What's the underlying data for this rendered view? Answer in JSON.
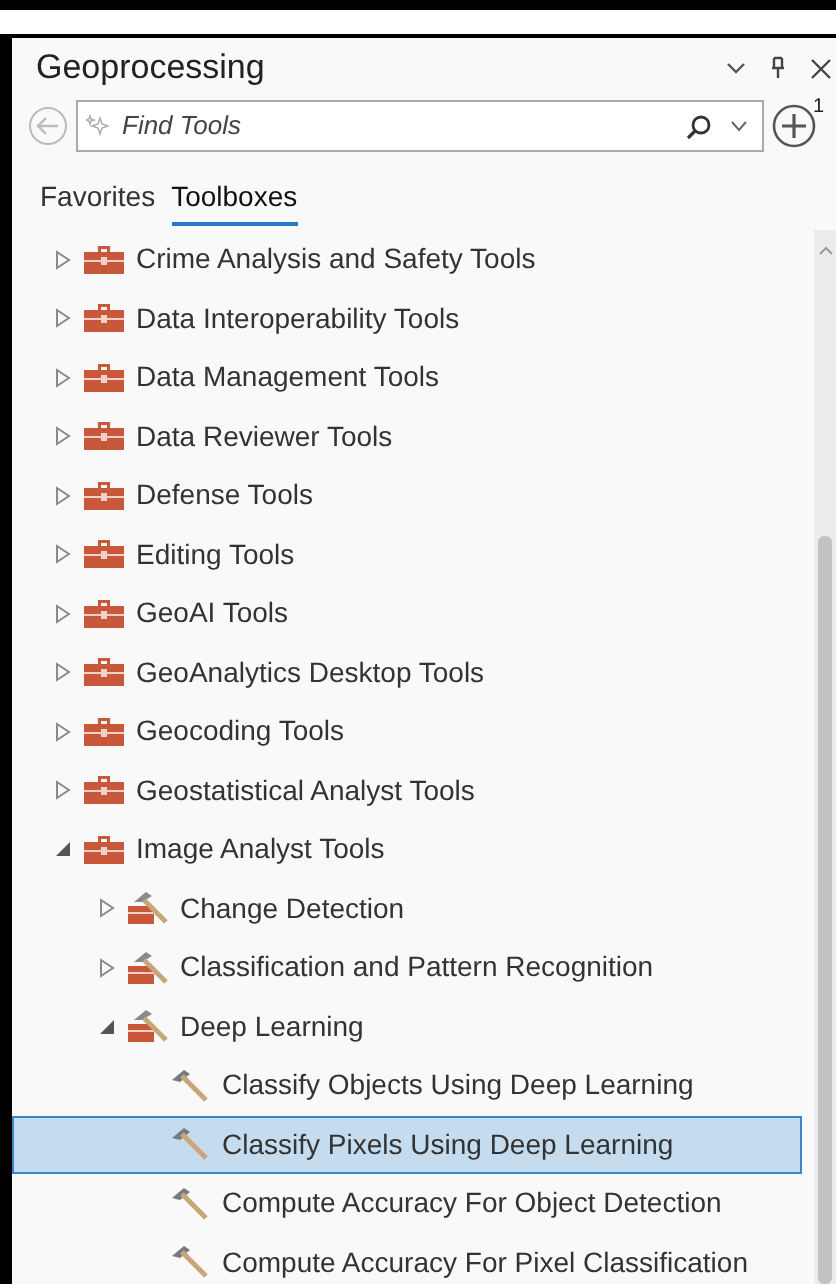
{
  "panel": {
    "title": "Geoprocessing",
    "search": {
      "placeholder": "Find Tools"
    },
    "add_badge": "1"
  },
  "tabs": [
    {
      "label": "Favorites",
      "selected": false
    },
    {
      "label": "Toolboxes",
      "selected": true
    }
  ],
  "tree": [
    {
      "kind": "toolbox",
      "label": "Crime Analysis and Safety Tools",
      "expanded": false,
      "selected": false
    },
    {
      "kind": "toolbox",
      "label": "Data Interoperability Tools",
      "expanded": false,
      "selected": false
    },
    {
      "kind": "toolbox",
      "label": "Data Management Tools",
      "expanded": false,
      "selected": false
    },
    {
      "kind": "toolbox",
      "label": "Data Reviewer Tools",
      "expanded": false,
      "selected": false
    },
    {
      "kind": "toolbox",
      "label": "Defense Tools",
      "expanded": false,
      "selected": false
    },
    {
      "kind": "toolbox",
      "label": "Editing Tools",
      "expanded": false,
      "selected": false
    },
    {
      "kind": "toolbox",
      "label": "GeoAI Tools",
      "expanded": false,
      "selected": false
    },
    {
      "kind": "toolbox",
      "label": "GeoAnalytics Desktop Tools",
      "expanded": false,
      "selected": false
    },
    {
      "kind": "toolbox",
      "label": "Geocoding Tools",
      "expanded": false,
      "selected": false
    },
    {
      "kind": "toolbox",
      "label": "Geostatistical Analyst Tools",
      "expanded": false,
      "selected": false
    },
    {
      "kind": "toolbox",
      "label": "Image Analyst Tools",
      "expanded": true,
      "selected": false,
      "children": [
        {
          "kind": "toolset",
          "label": "Change Detection",
          "expanded": false,
          "selected": false
        },
        {
          "kind": "toolset",
          "label": "Classification and Pattern Recognition",
          "expanded": false,
          "selected": false
        },
        {
          "kind": "toolset",
          "label": "Deep Learning",
          "expanded": true,
          "selected": false,
          "children": [
            {
              "kind": "tool",
              "label": "Classify Objects Using Deep Learning",
              "selected": false
            },
            {
              "kind": "tool",
              "label": "Classify Pixels Using Deep Learning",
              "selected": true
            },
            {
              "kind": "tool",
              "label": "Compute Accuracy For Object Detection",
              "selected": false
            },
            {
              "kind": "tool",
              "label": "Compute Accuracy For Pixel Classification",
              "selected": false
            }
          ]
        }
      ]
    }
  ]
}
